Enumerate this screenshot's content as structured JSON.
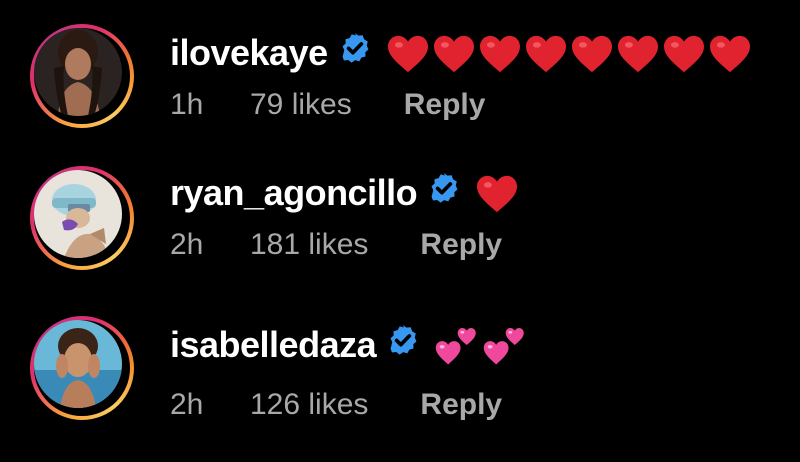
{
  "comments": [
    {
      "username": "ilovekaye",
      "verified": true,
      "emoji": [
        "heart-red",
        "heart-red",
        "heart-red",
        "heart-red",
        "heart-red",
        "heart-red",
        "heart-red",
        "heart-red"
      ],
      "time": "1h",
      "likes": "79 likes",
      "reply": "Reply"
    },
    {
      "username": "ryan_agoncillo",
      "verified": true,
      "emoji": [
        "heart-red"
      ],
      "time": "2h",
      "likes": "181 likes",
      "reply": "Reply"
    },
    {
      "username": "isabelledaza",
      "verified": true,
      "emoji": [
        "two-hearts-pink",
        "two-hearts-pink"
      ],
      "time": "2h",
      "likes": "126 likes",
      "reply": "Reply"
    }
  ],
  "colors": {
    "verified_blue": "#3897f0",
    "heart_red": "#e0232e",
    "heart_pink": "#f0489c",
    "meta_gray": "#a8a8a8"
  }
}
